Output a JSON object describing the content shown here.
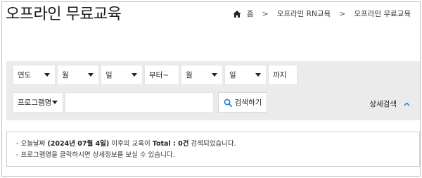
{
  "page": {
    "title": "오프라인 무료교육"
  },
  "breadcrumb": {
    "home": "홈",
    "sep": ">",
    "level1": "오프라인 RN교육",
    "level2": "오프라인 무료교육"
  },
  "filters": {
    "year": "연도",
    "month_from": "월",
    "day_from": "일",
    "from_label": "부터~",
    "month_to": "월",
    "day_to": "일",
    "to_label": "까지",
    "program_name": "프로그램명",
    "search_input_value": "",
    "search_button": "검색하기",
    "advanced_search": "상세검색"
  },
  "notice": {
    "line1_prefix": "- 오늘날짜 ",
    "line1_date": "(2024년 07월 4일)",
    "line1_mid": " 이후의 교육이 ",
    "line1_total": "Total : 0건",
    "line1_suffix": " 검색되었습니다.",
    "line2": "- 프로그램명을 클릭하시면 상세정보를 보실 수 있습니다."
  },
  "icons": {
    "home": "home-icon",
    "search": "search-icon",
    "chevron_up": "chevron-up-icon",
    "caret": "caret-down-icon"
  },
  "colors": {
    "accent": "#1a7fd4",
    "panel_bg": "#ebebeb"
  }
}
